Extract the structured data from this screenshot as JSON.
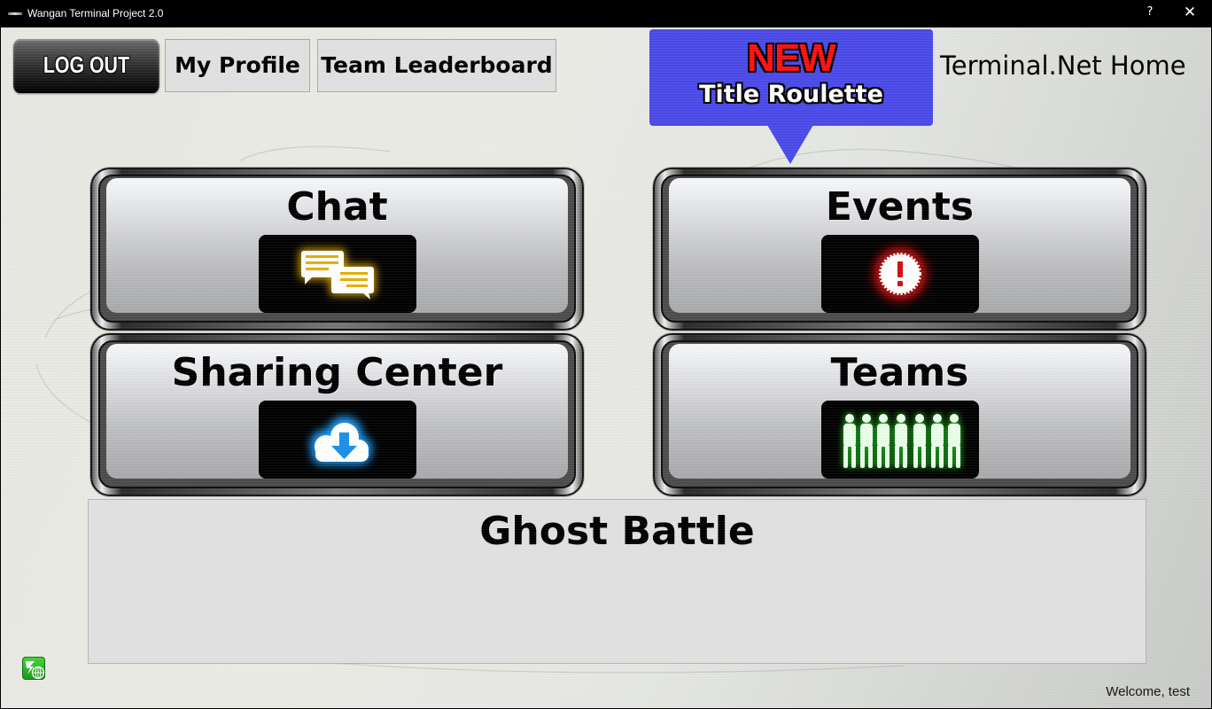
{
  "window": {
    "title": "Wangan Terminal Project 2.0",
    "help_label": "?",
    "close_label": "✕"
  },
  "header": {
    "logout_label": "LOG OUT",
    "profile_label": "My Profile",
    "leaderboard_label": "Team Leaderboard",
    "home_title": "Terminal.Net Home"
  },
  "callout": {
    "badge": "NEW",
    "text": "Title Roulette",
    "color": "#4a4aea",
    "badge_color": "#ff1010"
  },
  "tiles": [
    {
      "label": "Chat",
      "icon": "chat-bubbles-icon",
      "glow": "#f0b800"
    },
    {
      "label": "Events",
      "icon": "alert-burst-icon",
      "glow": "#e01010"
    },
    {
      "label": "Sharing Center",
      "icon": "cloud-download-icon",
      "glow": "#1aa0ff"
    },
    {
      "label": "Teams",
      "icon": "team-silhouettes-icon",
      "glow": "#22dd22"
    }
  ],
  "ghost_battle": {
    "label": "Ghost Battle"
  },
  "footer": {
    "logo_icon": "terminal-net-globe-icon",
    "welcome": "Welcome, test"
  }
}
